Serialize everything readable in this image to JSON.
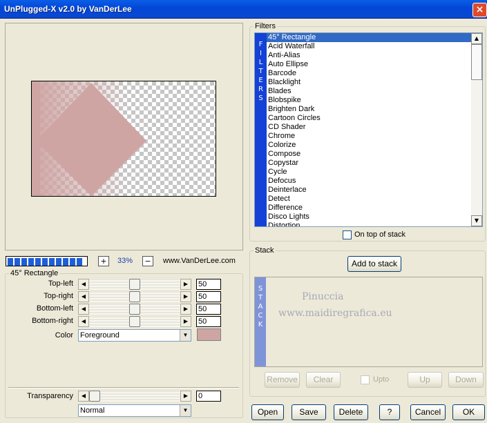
{
  "window": {
    "title": "UnPlugged-X v2.0 by VanDerLee",
    "close_glyph": "×"
  },
  "filters": {
    "group_label": "Filters",
    "band_text": "F I L T E R S",
    "items": [
      "45° Rectangle",
      "Acid Waterfall",
      "Anti-Alias",
      "Auto Ellipse",
      "Barcode",
      "Blacklight",
      "Blades",
      "Blobspike",
      "Brighten Dark",
      "Cartoon Circles",
      "CD Shader",
      "Chrome",
      "Colorize",
      "Compose",
      "Copystar",
      "Cycle",
      "Defocus",
      "Deinterlace",
      "Detect",
      "Difference",
      "Disco Lights",
      "Distortion"
    ],
    "selected_index": 0,
    "on_top_label": "On top of stack",
    "on_top_checked": false
  },
  "stack": {
    "group_label": "Stack",
    "band_text": "S T A C K",
    "add_button": "Add to stack",
    "remove": "Remove",
    "clear": "Clear",
    "upto": "Upto",
    "up": "Up",
    "down": "Down"
  },
  "watermark": {
    "line1": "Pinuccia",
    "line2": "www.maidiregrafica.eu"
  },
  "zoom": {
    "plus": "+",
    "minus": "−",
    "value": "33%",
    "progress": 1.0,
    "link": "www.VanDerLee.com"
  },
  "params": {
    "group_label": "45° Rectangle",
    "rows": [
      {
        "label": "Top-left",
        "value": "50"
      },
      {
        "label": "Top-right",
        "value": "50"
      },
      {
        "label": "Bottom-left",
        "value": "50"
      },
      {
        "label": "Bottom-right",
        "value": "50"
      }
    ],
    "color_label": "Color",
    "color_value": "Foreground",
    "swatch_color": "#cfa5a4",
    "transparency_label": "Transparency",
    "transparency_value": "0",
    "blend_value": "Normal"
  },
  "buttons": {
    "open": "Open",
    "save": "Save",
    "delete": "Delete",
    "help": "?",
    "cancel": "Cancel",
    "ok": "OK"
  },
  "colors": {
    "shape": "#cfa5a4",
    "titlebar": "#0346d6",
    "band": "#1441d6"
  }
}
